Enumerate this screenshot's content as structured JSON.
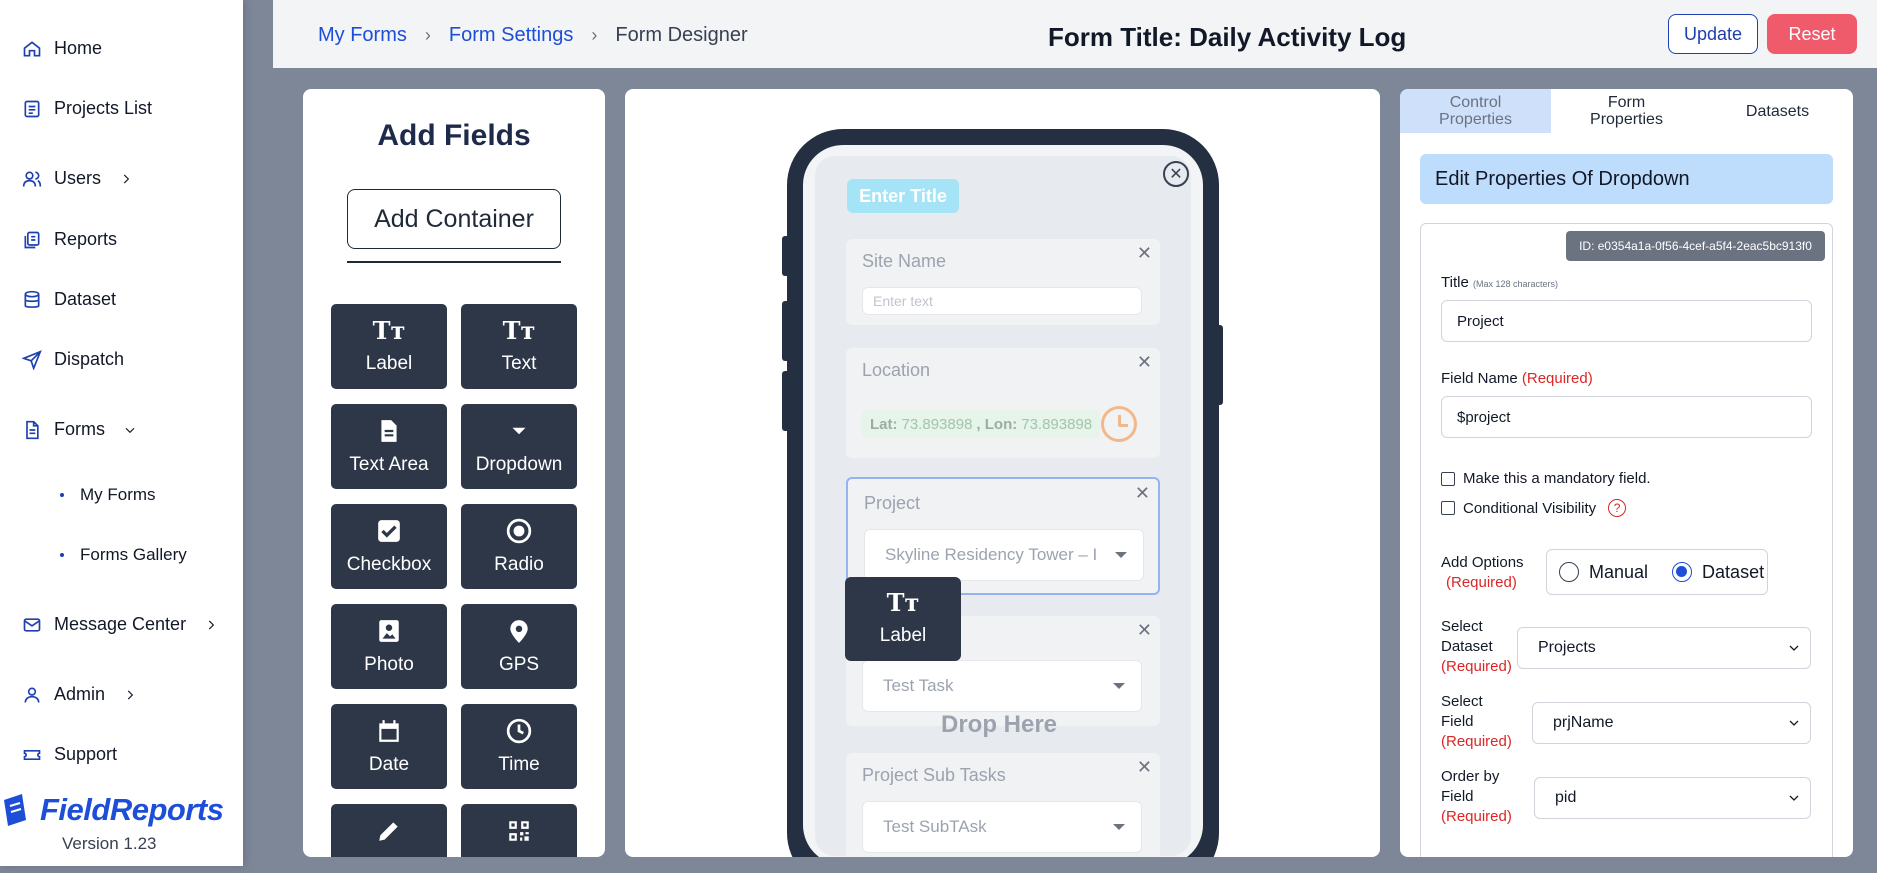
{
  "sidebar": {
    "items": [
      {
        "label": "Home",
        "icon": "home-icon"
      },
      {
        "label": "Projects List",
        "icon": "list-icon"
      },
      {
        "label": "Users",
        "icon": "users-icon"
      },
      {
        "label": "Reports",
        "icon": "reports-icon"
      },
      {
        "label": "Dataset",
        "icon": "database-icon"
      },
      {
        "label": "Dispatch",
        "icon": "send-icon"
      },
      {
        "label": "Forms",
        "icon": "document-icon"
      },
      {
        "label": "Message Center",
        "icon": "mail-icon"
      },
      {
        "label": "Admin",
        "icon": "user-icon"
      },
      {
        "label": "Support",
        "icon": "ticket-icon"
      }
    ],
    "sub_items": [
      "My Forms",
      "Forms Gallery"
    ],
    "brand": "FieldReports",
    "version": "Version 1.23"
  },
  "header": {
    "crumbs": [
      "My Forms",
      "Form Settings",
      "Form Designer"
    ],
    "title": "Form Title: Daily Activity Log",
    "update_label": "Update",
    "reset_label": "Reset"
  },
  "add_fields": {
    "title": "Add Fields",
    "container_label": "Add Container",
    "tools": [
      "Label",
      "Text",
      "Text Area",
      "Dropdown",
      "Checkbox",
      "Radio",
      "Photo",
      "GPS",
      "Date",
      "Time"
    ]
  },
  "canvas": {
    "enter_title": "Enter Title",
    "fields": {
      "site_name": {
        "label": "Site Name",
        "placeholder": "Enter text"
      },
      "location": {
        "label": "Location",
        "lat_label": "Lat:",
        "lat": "73.893898",
        "lon_label": ", Lon:",
        "lon": "73.893898"
      },
      "project": {
        "label": "Project",
        "value": "Skyline Residency Tower – I"
      },
      "task": {
        "value": "Test Task"
      },
      "subtasks": {
        "label": "Project Sub Tasks",
        "value": "Test SubTAsk"
      }
    },
    "drag_label": "Label",
    "drop_here": "Drop Here"
  },
  "props": {
    "tabs": [
      "Control Properties",
      "Form Properties",
      "Datasets"
    ],
    "edit_heading": "Edit Properties Of Dropdown",
    "id_chip": "ID: e0354a1a-0f56-4cef-a5f4-2eac5bc913f0",
    "title_label": "Title",
    "title_hint": "(Max 128 characters)",
    "title_value": "Project",
    "field_name_label": "Field Name",
    "required_text": "(Required)",
    "field_name_value": "$project",
    "mandatory_label": "Make this a mandatory field.",
    "visibility_label": "Conditional Visibility",
    "add_options_label": "Add Options",
    "radio_manual": "Manual",
    "radio_dataset": "Dataset",
    "select_dataset_label": [
      "Select",
      "Dataset"
    ],
    "select_dataset_value": "Projects",
    "select_field_label": [
      "Select",
      "Field"
    ],
    "select_field_value": "prjName",
    "order_by_label": [
      "Order by",
      "Field"
    ],
    "order_by_value": "pid"
  },
  "colors": {
    "accent": "#1d4ed8",
    "reset": "#ef5b6b",
    "tool_bg": "#2d3748",
    "active_tab": "#cfe0fb"
  }
}
